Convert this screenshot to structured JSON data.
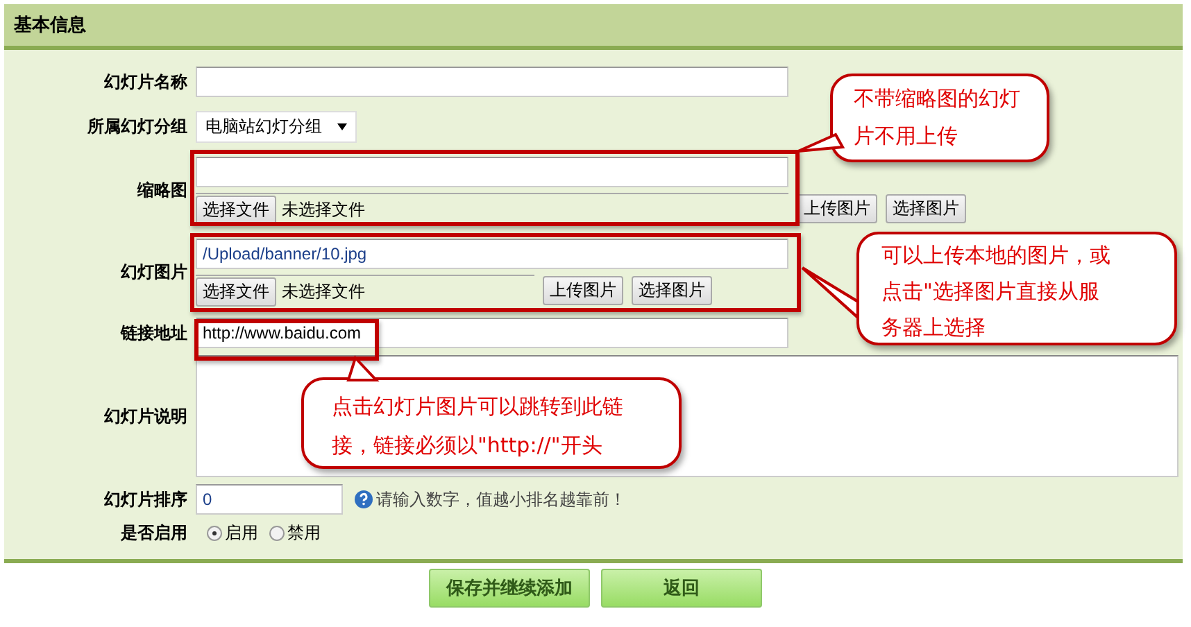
{
  "panel_title": "基本信息",
  "name_field": {
    "label": "幻灯片名称"
  },
  "group_field": {
    "label": "所属幻灯分组",
    "value": "电脑站幻灯分组"
  },
  "thumbnail_field": {
    "label": "缩略图",
    "file_button": "选择文件",
    "file_status": "未选择文件",
    "upload_button": "上传图片",
    "pick_button": "选择图片"
  },
  "image_field": {
    "label": "幻灯图片",
    "value": "/Upload/banner/10.jpg",
    "file_button": "选择文件",
    "file_status": "未选择文件",
    "upload_button": "上传图片",
    "pick_button": "选择图片"
  },
  "link_field": {
    "label": "链接地址",
    "value": "http://www.baidu.com"
  },
  "description_field": {
    "label": "幻灯片说明"
  },
  "order_field": {
    "label": "幻灯片排序",
    "value": "0",
    "hint": "请输入数字，值越小排名越靠前！"
  },
  "enabled_field": {
    "label": "是否启用",
    "options": [
      {
        "label": "启用",
        "selected": true
      },
      {
        "label": "禁用",
        "selected": false
      }
    ]
  },
  "buttons": [
    "保存并继续添加",
    "返回"
  ],
  "annotations": [
    {
      "text": "不带缩略图的幻灯片不用上传",
      "kind": "thumbnail"
    },
    {
      "text": "可以上传本地的图片，或点击\"选择图片直接从服务器上选择",
      "kind": "image"
    },
    {
      "text": "点击幻灯片图片可以跳转到此链接，链接必须以\"http://\"开头",
      "kind": "link"
    }
  ]
}
